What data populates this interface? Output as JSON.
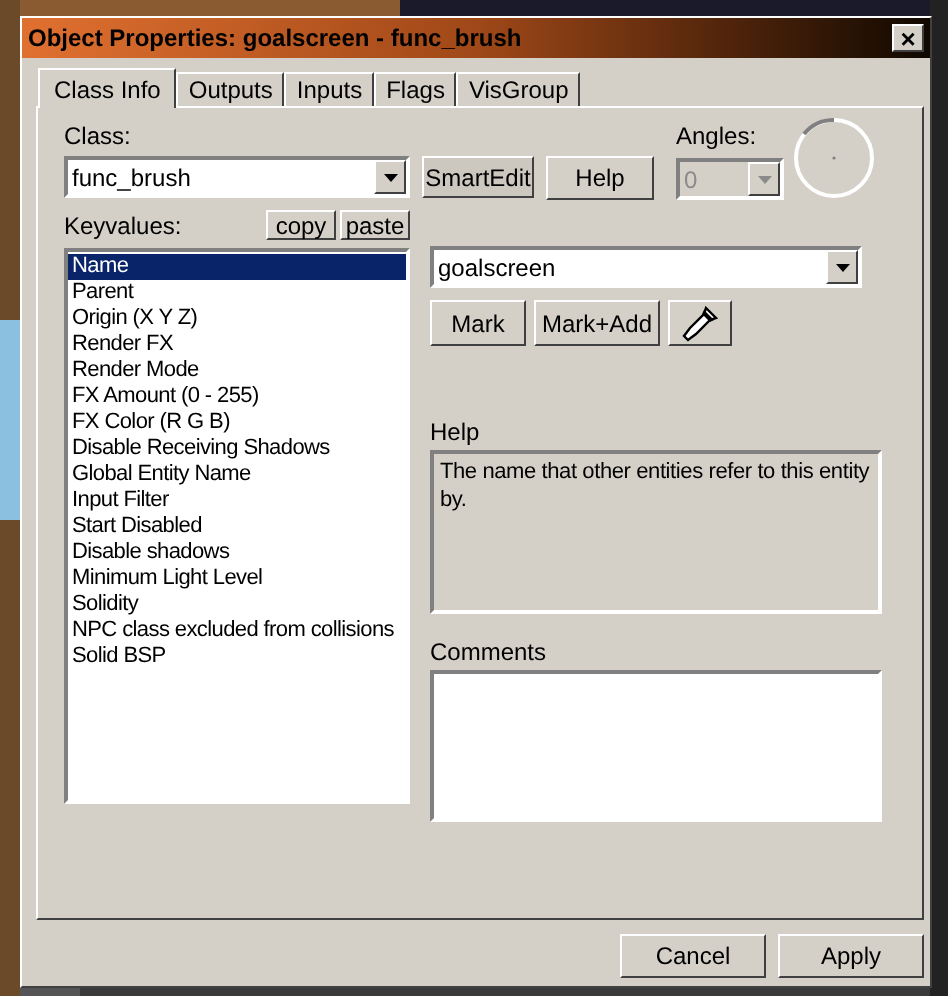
{
  "window": {
    "title": "Object Properties: goalscreen - func_brush",
    "close": "×"
  },
  "tabs": [
    {
      "label": "Class Info",
      "selected": true
    },
    {
      "label": "Outputs",
      "selected": false
    },
    {
      "label": "Inputs",
      "selected": false
    },
    {
      "label": "Flags",
      "selected": false
    },
    {
      "label": "VisGroup",
      "selected": false
    }
  ],
  "class": {
    "label": "Class:",
    "value": "func_brush"
  },
  "class_buttons": [
    "SmartEdit",
    "Help"
  ],
  "angles": {
    "label": "Angles:",
    "value": "0",
    "disabled": true
  },
  "keyvalues": {
    "label": "Keyvalues:",
    "buttons": [
      "copy",
      "paste"
    ],
    "items": [
      {
        "label": "Name",
        "selected": true
      },
      {
        "label": "Parent",
        "selected": false
      },
      {
        "label": "Origin (X Y Z)",
        "selected": false
      },
      {
        "label": "Render FX",
        "selected": false
      },
      {
        "label": "Render Mode",
        "selected": false
      },
      {
        "label": "FX Amount (0 - 255)",
        "selected": false
      },
      {
        "label": "FX Color (R G B)",
        "selected": false
      },
      {
        "label": "Disable Receiving Shadows",
        "selected": false
      },
      {
        "label": "Global Entity Name",
        "selected": false
      },
      {
        "label": "Input Filter",
        "selected": false
      },
      {
        "label": "Start Disabled",
        "selected": false
      },
      {
        "label": "Disable shadows",
        "selected": false
      },
      {
        "label": "Minimum Light Level",
        "selected": false
      },
      {
        "label": "Solidity",
        "selected": false
      },
      {
        "label": "NPC class excluded from collisions",
        "selected": false
      },
      {
        "label": "Solid BSP",
        "selected": false
      }
    ]
  },
  "value": {
    "value": "goalscreen"
  },
  "mark_buttons": [
    "Mark",
    "Mark+Add"
  ],
  "help": {
    "label": "Help",
    "text": "The name that other entities refer to this entity by."
  },
  "comments": {
    "label": "Comments"
  },
  "buttons": [
    "Cancel",
    "Apply"
  ]
}
